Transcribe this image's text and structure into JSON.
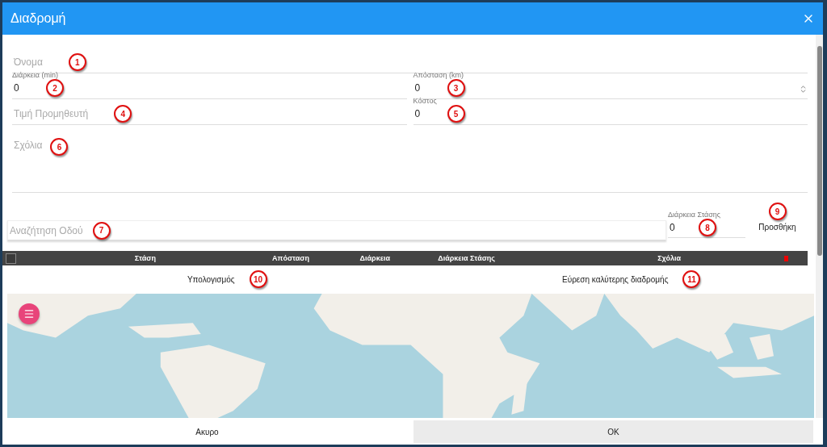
{
  "dialog": {
    "title": "Διαδρομή"
  },
  "form_rows": [
    [
      {
        "placeholder": "Όνομα",
        "callout": "1"
      }
    ],
    [
      {
        "label": "Διάρκεια (min)",
        "value": "0",
        "callout": "2"
      },
      {
        "label": "Απόσταση (km)",
        "value": "0",
        "callout": "3",
        "spinner": true
      }
    ],
    [
      {
        "placeholder": "Τιμή Προμηθευτή",
        "callout": "4"
      },
      {
        "label": "Κόστος",
        "value": "0",
        "callout": "5"
      }
    ]
  ],
  "comments": {
    "placeholder": "Σχόλια",
    "callout": "6"
  },
  "stop_entry": {
    "search": {
      "placeholder": "Αναζήτηση Οδού",
      "callout": "7"
    },
    "stop_duration": {
      "label": "Διάρκεια Στάσης",
      "value": "0",
      "callout": "8"
    },
    "add_button": {
      "label": "Προσθήκη",
      "callout": "9"
    }
  },
  "table": {
    "select_all": {
      "checked": false
    },
    "columns": [
      "Στάση",
      "Απόσταση",
      "Διάρκεια",
      "Διάρκεια Στάσης",
      "Σχόλια"
    ]
  },
  "actions": [
    {
      "label": "Υπολογισμός",
      "callout": "10"
    },
    {
      "label": "Εύρεση καλύτερης διαδρομής",
      "callout": "11"
    }
  ],
  "map": {
    "kind": "picture"
  },
  "footer": {
    "cancel": "Ακυρο",
    "ok": "OK"
  }
}
